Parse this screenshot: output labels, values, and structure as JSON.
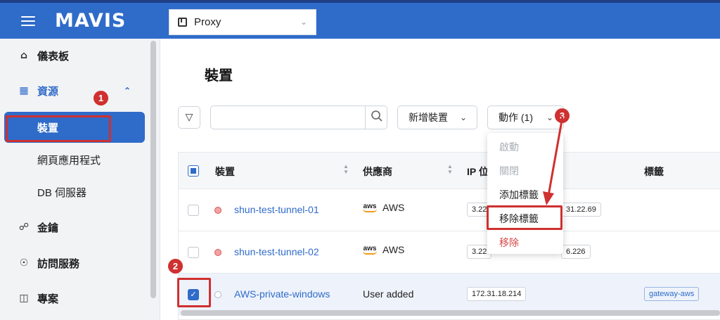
{
  "topbar": {
    "logo": "MAVIS",
    "project_select": {
      "value": "Proxy"
    }
  },
  "sidebar": {
    "items": [
      {
        "label": "儀表板",
        "icon": "home-icon"
      },
      {
        "label": "資源",
        "icon": "resource-tree-icon"
      },
      {
        "label": "裝置",
        "icon": ""
      },
      {
        "label": "網頁應用程式",
        "icon": ""
      },
      {
        "label": "DB 伺服器",
        "icon": ""
      },
      {
        "label": "金鑰",
        "icon": "key-icon"
      },
      {
        "label": "訪問服務",
        "icon": "shield-icon"
      },
      {
        "label": "專案",
        "icon": "project-icon"
      }
    ]
  },
  "main": {
    "title": "裝置",
    "search": {
      "placeholder": "",
      "value": ""
    },
    "add_device_label": "新增裝置",
    "actions_label": "動作 (1)",
    "table": {
      "headers": [
        "裝置",
        "供應商",
        "IP 位",
        "標籤"
      ],
      "rows": [
        {
          "name": "shun-test-tunnel-01",
          "vendor": "AWS",
          "ip1": "3.22",
          "ip2": "31.22.69",
          "tag": "",
          "status": "red",
          "checked": false
        },
        {
          "name": "shun-test-tunnel-02",
          "vendor": "AWS",
          "ip1": "3.22",
          "ip2": "6.226",
          "tag": "",
          "status": "red",
          "checked": false
        },
        {
          "name": "AWS-private-windows",
          "vendor": "User added",
          "ip1": "172.31.18.214",
          "ip2": "",
          "tag": "gateway-aws",
          "status": "grey",
          "checked": true
        }
      ]
    }
  },
  "dropdown": {
    "items": [
      "啟動",
      "關閉",
      "添加標籤",
      "移除標籤",
      "移除"
    ]
  },
  "annotations": {
    "steps": [
      "1",
      "2",
      "3"
    ]
  },
  "colors": {
    "brand": "#2f6bc9",
    "highlight": "#cf3030",
    "danger": "#d94545"
  }
}
